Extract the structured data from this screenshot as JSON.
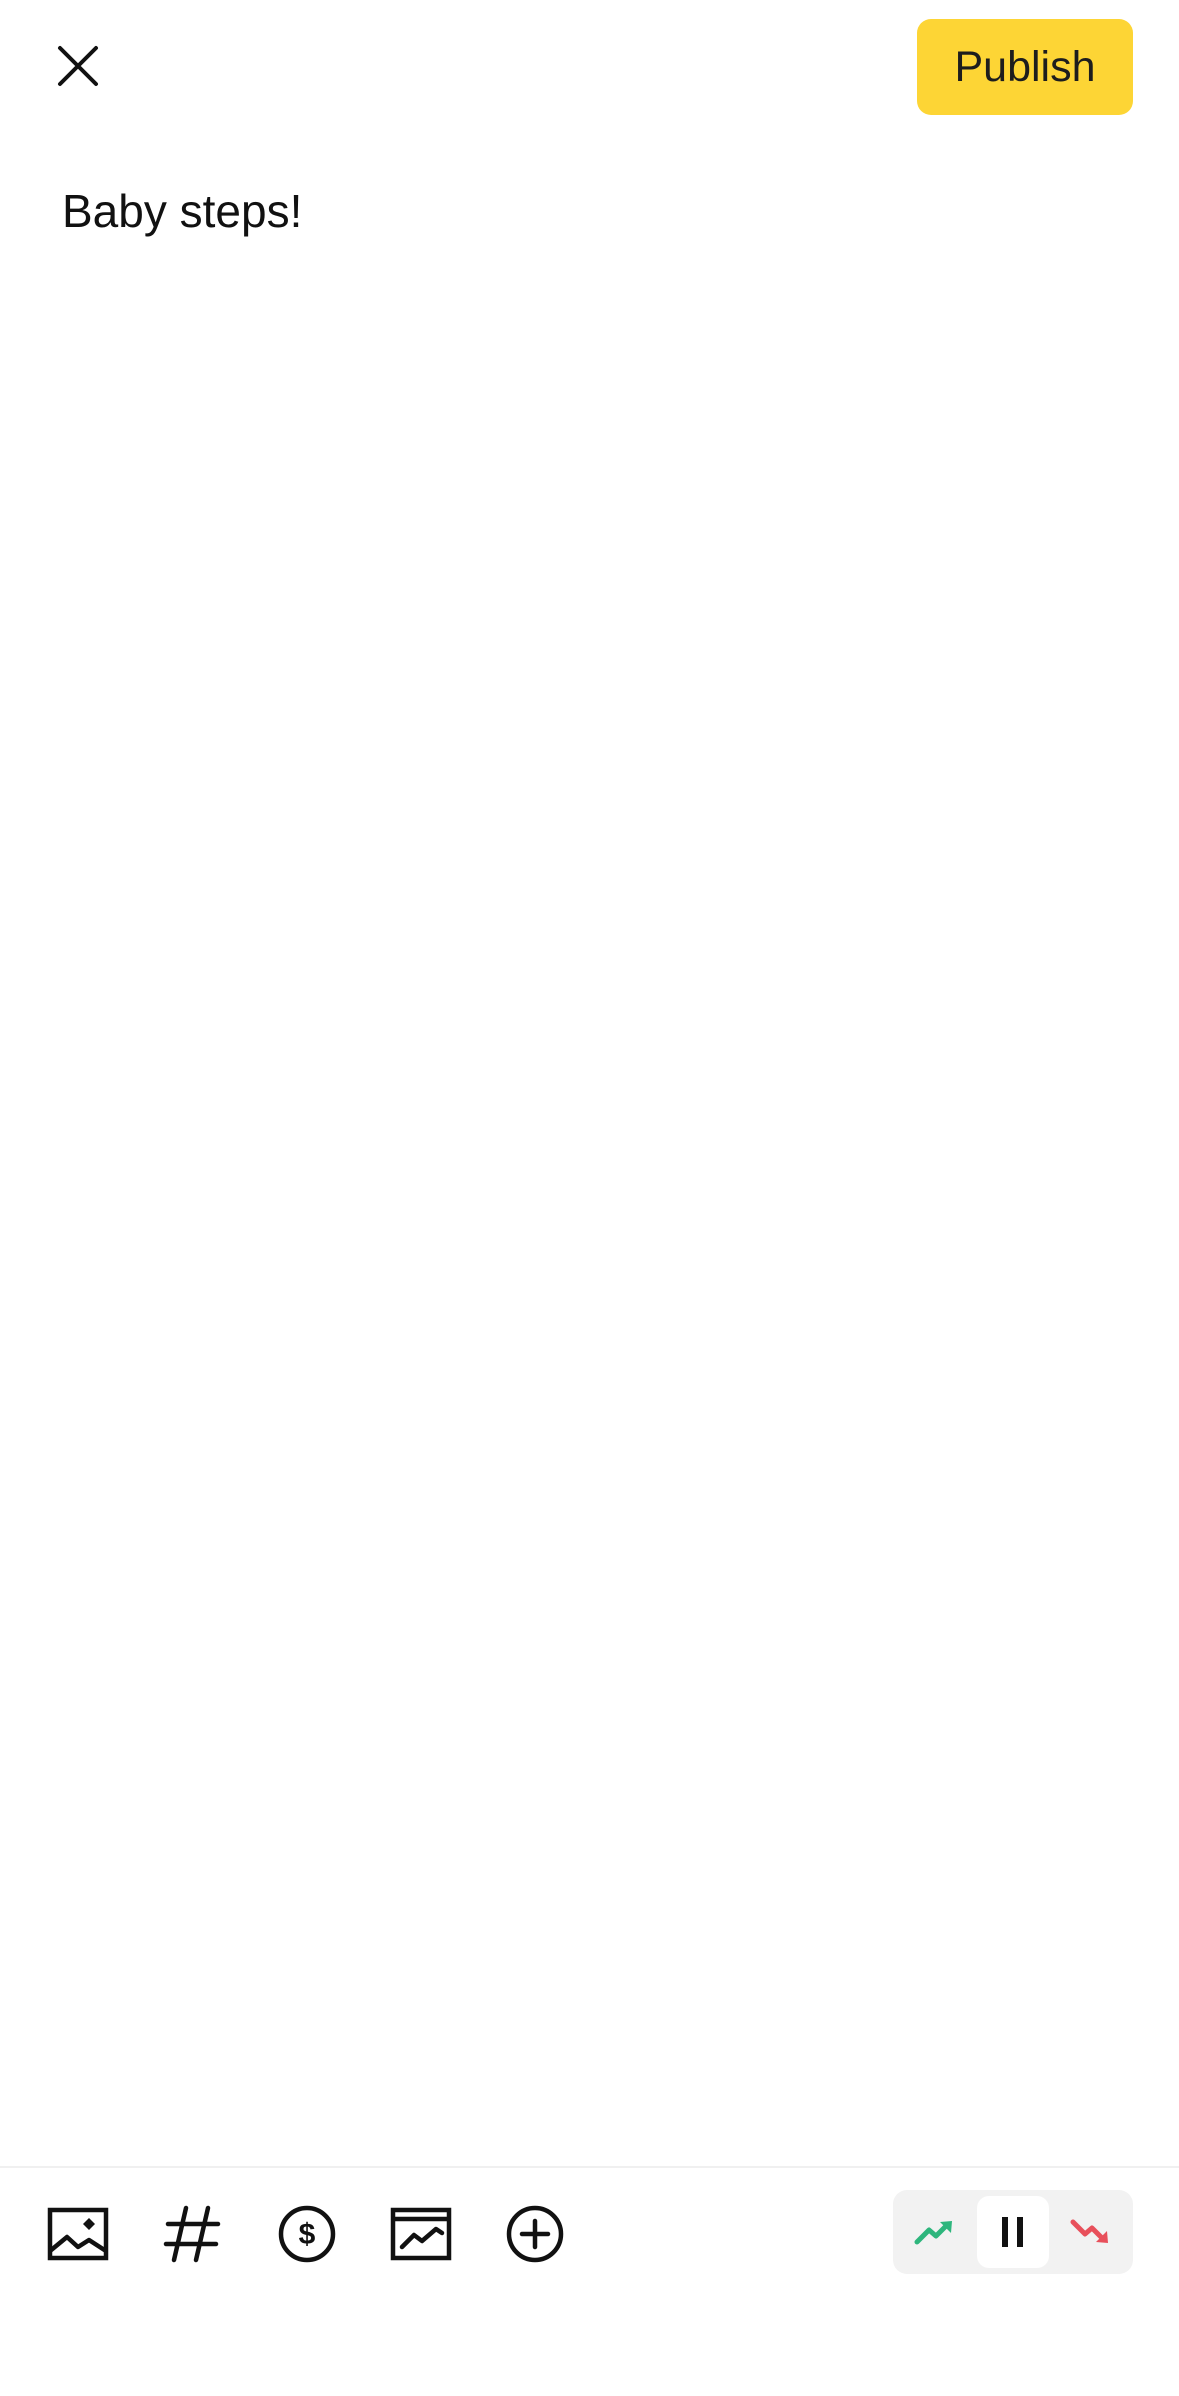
{
  "header": {
    "publish_label": "Publish"
  },
  "compose": {
    "text": "Baby steps!"
  },
  "toolbar": {
    "tools": [
      "image-icon",
      "hashtag-icon",
      "dollar-icon",
      "chart-icon",
      "add-icon"
    ]
  },
  "sentiment": {
    "options": [
      "bullish",
      "neutral",
      "bearish"
    ],
    "selected": "neutral",
    "colors": {
      "bullish": "#2EB67D",
      "bearish": "#E8505B"
    }
  },
  "colors": {
    "accent": "#FDD535"
  }
}
